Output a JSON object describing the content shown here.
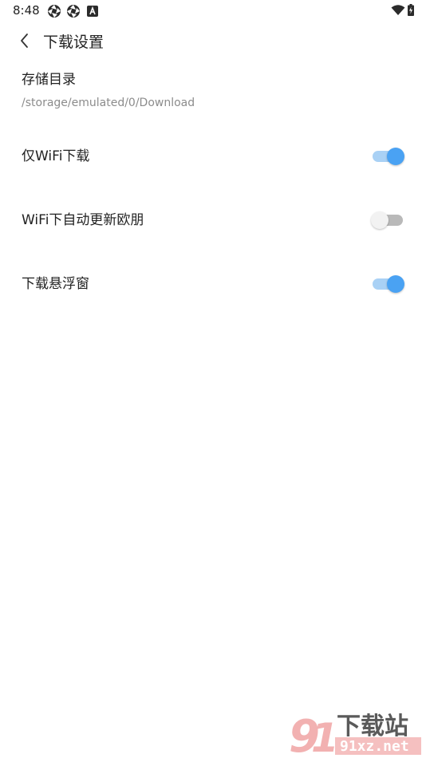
{
  "status_bar": {
    "time": "8:48",
    "notification_icons": [
      "aperture-icon",
      "aperture-icon",
      "text-a-icon"
    ],
    "wifi_icon": "wifi-icon",
    "battery_icon": "battery-charging-icon"
  },
  "header": {
    "back_icon": "chevron-left-icon",
    "title": "下载设置"
  },
  "storage": {
    "title": "存储目录",
    "path": "/storage/emulated/0/Download"
  },
  "settings": [
    {
      "label": "仅WiFi下载",
      "enabled": true
    },
    {
      "label": "WiFi下自动更新欧朋",
      "enabled": false
    },
    {
      "label": "下载悬浮窗",
      "enabled": true
    }
  ],
  "colors": {
    "toggle_on_thumb": "#4aa2f3",
    "toggle_on_track": "#a9d1f5",
    "toggle_off_thumb": "#f2f2f2",
    "toggle_off_track": "#b9b9b9"
  },
  "watermark": {
    "main_text": "下载站",
    "sub_text": "91xz.net"
  }
}
